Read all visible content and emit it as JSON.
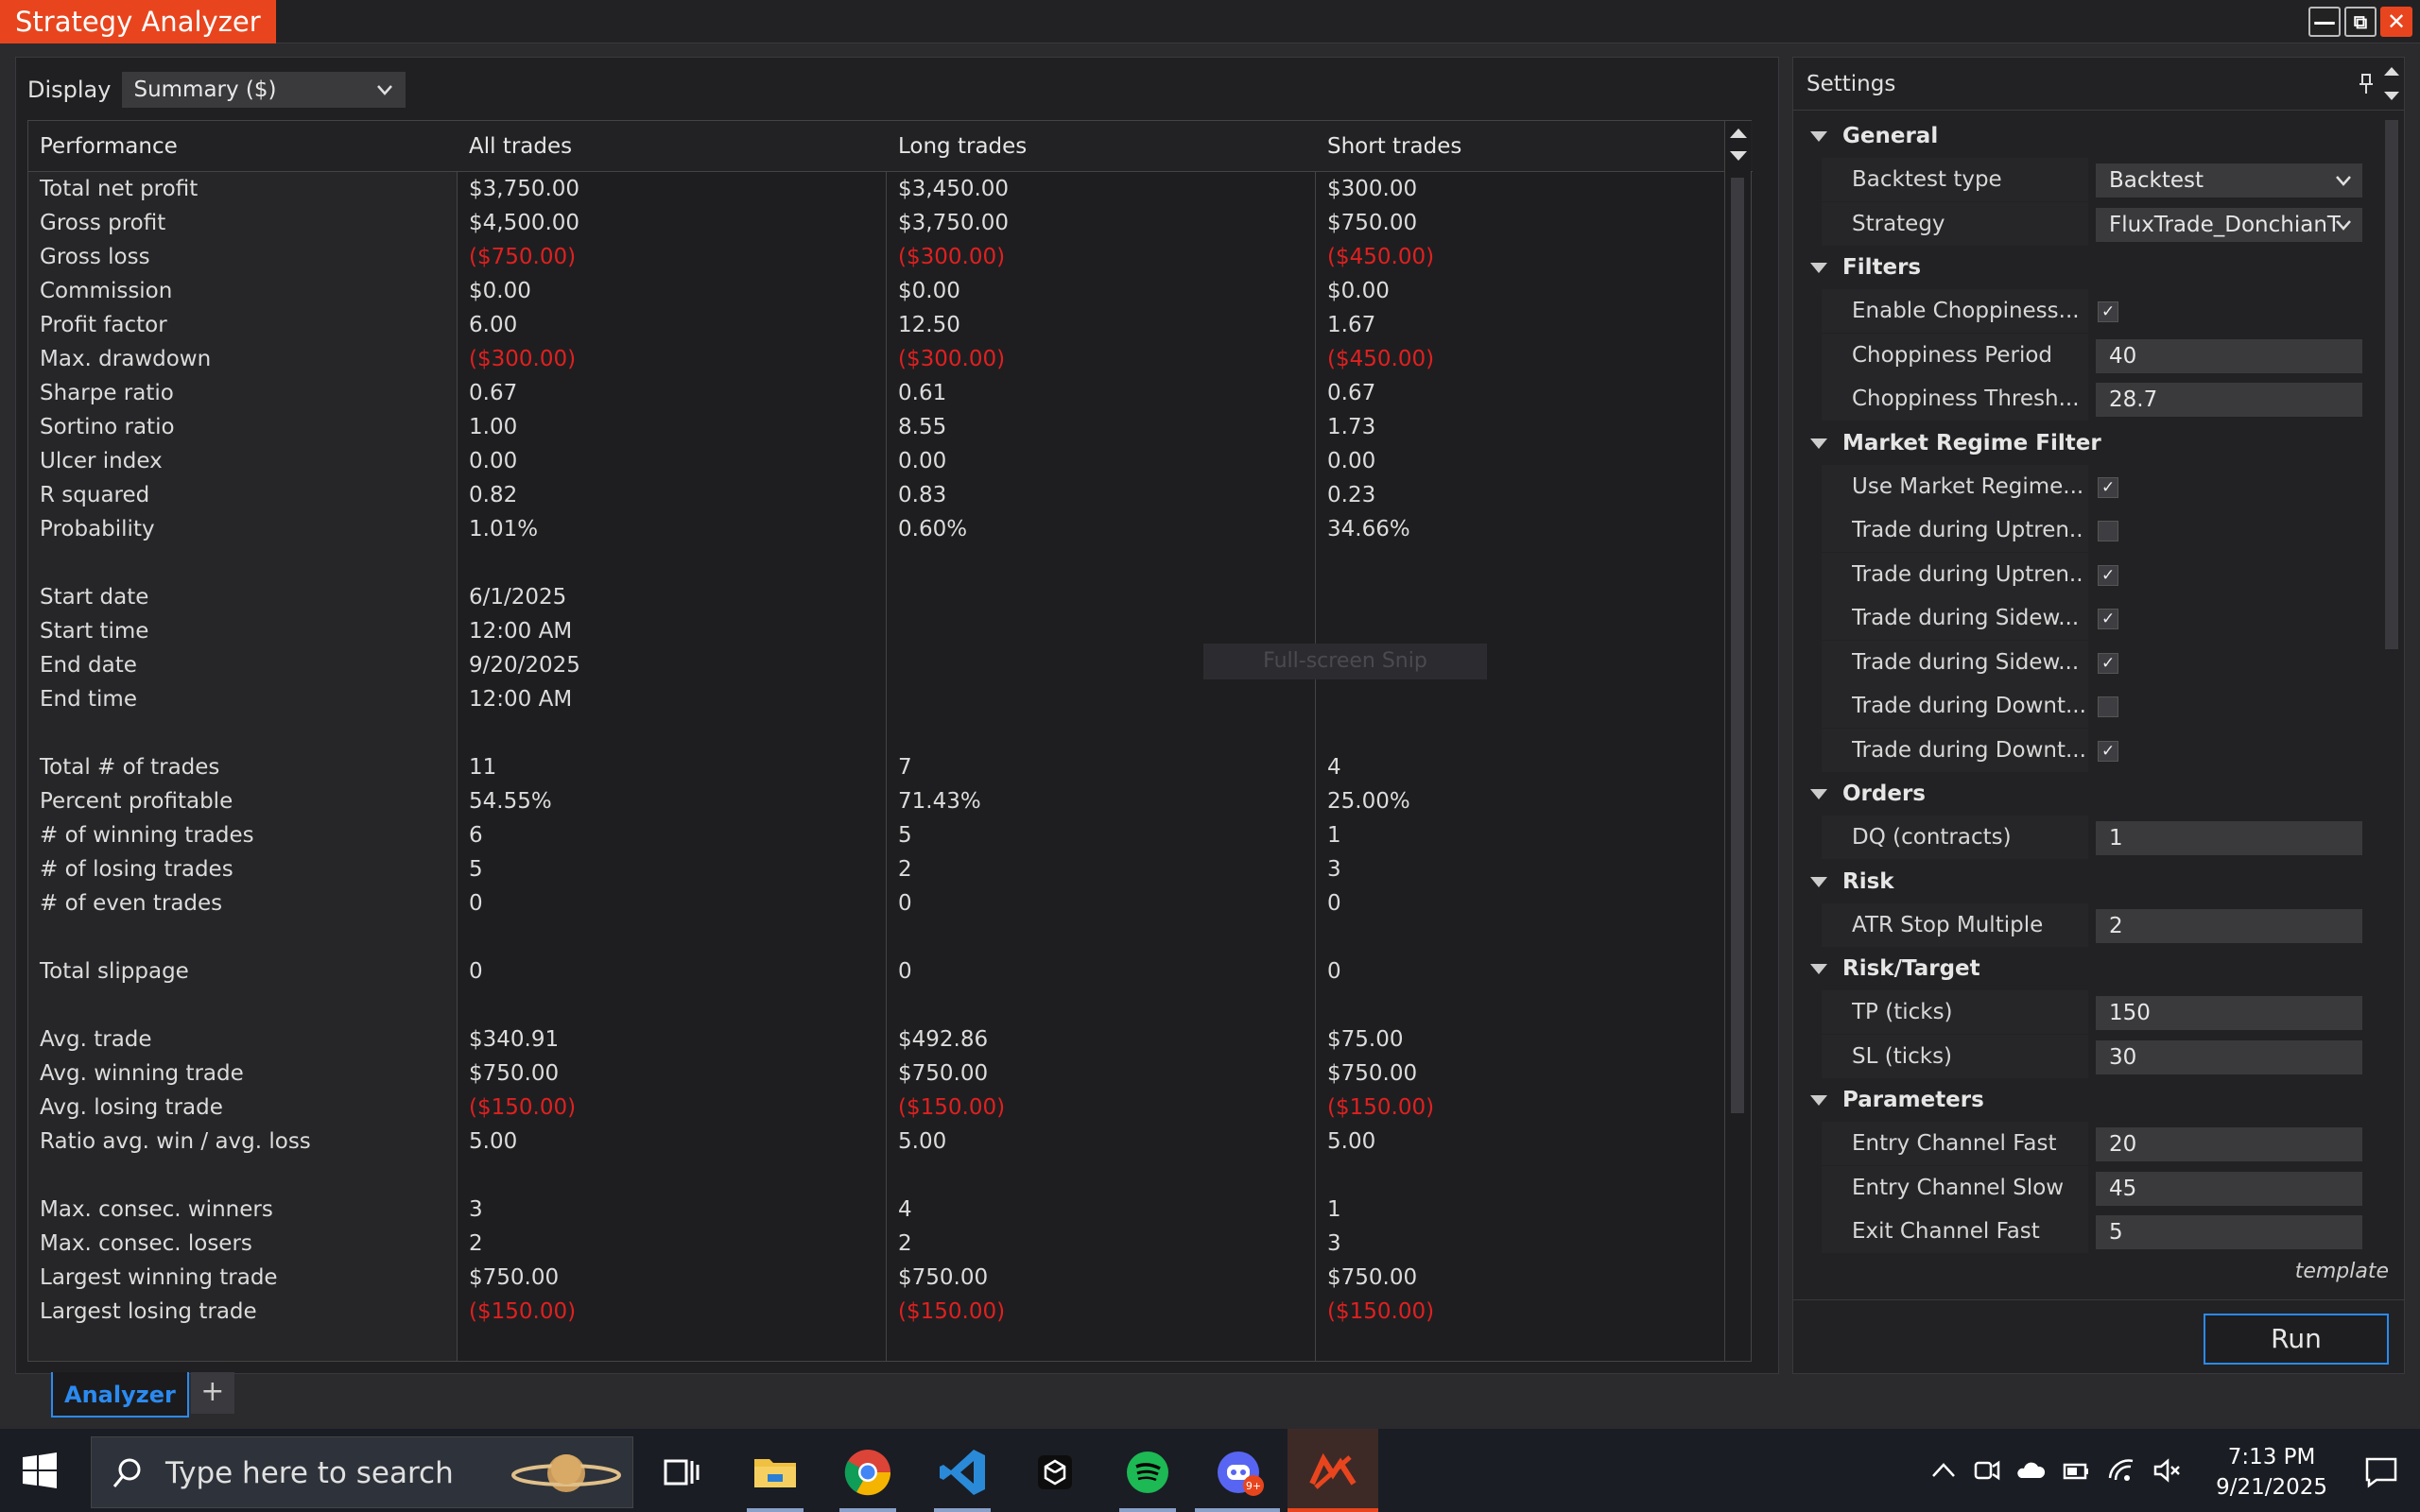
{
  "window": {
    "title": "Strategy Analyzer"
  },
  "display": {
    "label": "Display",
    "value": "Summary ($)"
  },
  "table": {
    "headers": [
      "Performance",
      "All trades",
      "Long trades",
      "Short trades"
    ],
    "rows": [
      [
        "Total net profit",
        "$3,750.00",
        "$3,450.00",
        "$300.00"
      ],
      [
        "Gross profit",
        "$4,500.00",
        "$3,750.00",
        "$750.00"
      ],
      [
        "Gross loss",
        "($750.00)",
        "($300.00)",
        "($450.00)"
      ],
      [
        "Commission",
        "$0.00",
        "$0.00",
        "$0.00"
      ],
      [
        "Profit factor",
        "6.00",
        "12.50",
        "1.67"
      ],
      [
        "Max. drawdown",
        "($300.00)",
        "($300.00)",
        "($450.00)"
      ],
      [
        "Sharpe ratio",
        "0.67",
        "0.61",
        "0.67"
      ],
      [
        "Sortino ratio",
        "1.00",
        "8.55",
        "1.73"
      ],
      [
        "Ulcer index",
        "0.00",
        "0.00",
        "0.00"
      ],
      [
        "R squared",
        "0.82",
        "0.83",
        "0.23"
      ],
      [
        "Probability",
        "1.01%",
        "0.60%",
        "34.66%"
      ],
      null,
      [
        "Start date",
        "6/1/2025",
        "",
        ""
      ],
      [
        "Start time",
        "12:00 AM",
        "",
        ""
      ],
      [
        "End date",
        "9/20/2025",
        "",
        ""
      ],
      [
        "End time",
        "12:00 AM",
        "",
        ""
      ],
      null,
      [
        "Total # of trades",
        "11",
        "7",
        "4"
      ],
      [
        "Percent profitable",
        "54.55%",
        "71.43%",
        "25.00%"
      ],
      [
        "# of winning trades",
        "6",
        "5",
        "1"
      ],
      [
        "# of losing trades",
        "5",
        "2",
        "3"
      ],
      [
        "# of even trades",
        "0",
        "0",
        "0"
      ],
      null,
      [
        "Total slippage",
        "0",
        "0",
        "0"
      ],
      null,
      [
        "Avg. trade",
        "$340.91",
        "$492.86",
        "$75.00"
      ],
      [
        "Avg. winning trade",
        "$750.00",
        "$750.00",
        "$750.00"
      ],
      [
        "Avg. losing trade",
        "($150.00)",
        "($150.00)",
        "($150.00)"
      ],
      [
        "Ratio avg. win / avg. loss",
        "5.00",
        "5.00",
        "5.00"
      ],
      null,
      [
        "Max. consec. winners",
        "3",
        "4",
        "1"
      ],
      [
        "Max. consec. losers",
        "2",
        "2",
        "3"
      ],
      [
        "Largest winning trade",
        "$750.00",
        "$750.00",
        "$750.00"
      ],
      [
        "Largest losing trade",
        "($150.00)",
        "($150.00)",
        "($150.00)"
      ]
    ]
  },
  "overlay": {
    "snip_label": "Full-screen Snip"
  },
  "tabs": {
    "active": "Analyzer",
    "add": "+"
  },
  "settings": {
    "title": "Settings",
    "sections": [
      {
        "name": "General",
        "props": [
          {
            "label": "Backtest type",
            "type": "select",
            "value": "Backtest"
          },
          {
            "label": "Strategy",
            "type": "select",
            "value": "FluxTrade_DonchianT"
          }
        ]
      },
      {
        "name": "Filters",
        "props": [
          {
            "label": "Enable Choppiness...",
            "type": "check",
            "checked": true
          },
          {
            "label": "Choppiness Period",
            "type": "text",
            "value": "40"
          },
          {
            "label": "Choppiness Thresh...",
            "type": "text",
            "value": "28.7"
          }
        ]
      },
      {
        "name": "Market Regime Filter",
        "props": [
          {
            "label": "Use Market Regime...",
            "type": "check",
            "checked": true
          },
          {
            "label": "Trade during Uptren...",
            "type": "check",
            "checked": false
          },
          {
            "label": "Trade during Uptren...",
            "type": "check",
            "checked": true
          },
          {
            "label": "Trade during Sidew...",
            "type": "check",
            "checked": true
          },
          {
            "label": "Trade during Sidew...",
            "type": "check",
            "checked": true
          },
          {
            "label": "Trade during Downt...",
            "type": "check",
            "checked": false
          },
          {
            "label": "Trade during Downt...",
            "type": "check",
            "checked": true
          }
        ]
      },
      {
        "name": "Orders",
        "props": [
          {
            "label": "DQ (contracts)",
            "type": "text",
            "value": "1"
          }
        ]
      },
      {
        "name": "Risk",
        "props": [
          {
            "label": "ATR Stop Multiple",
            "type": "text",
            "value": "2"
          }
        ]
      },
      {
        "name": "Risk/Target",
        "props": [
          {
            "label": "TP (ticks)",
            "type": "text",
            "value": "150"
          },
          {
            "label": "SL (ticks)",
            "type": "text",
            "value": "30"
          }
        ]
      },
      {
        "name": "Parameters",
        "props": [
          {
            "label": "Entry Channel Fast",
            "type": "text",
            "value": "20"
          },
          {
            "label": "Entry Channel Slow",
            "type": "text",
            "value": "45"
          },
          {
            "label": "Exit Channel Fast",
            "type": "text",
            "value": "5"
          }
        ]
      }
    ],
    "template_label": "template",
    "run_label": "Run"
  },
  "taskbar": {
    "search_placeholder": "Type here to search",
    "time": "7:13 PM",
    "date": "9/21/2025",
    "discord_badge": "9+"
  },
  "colors": {
    "accent": "#e8451e",
    "negative": "#e02020",
    "selection": "#2b8af0"
  }
}
